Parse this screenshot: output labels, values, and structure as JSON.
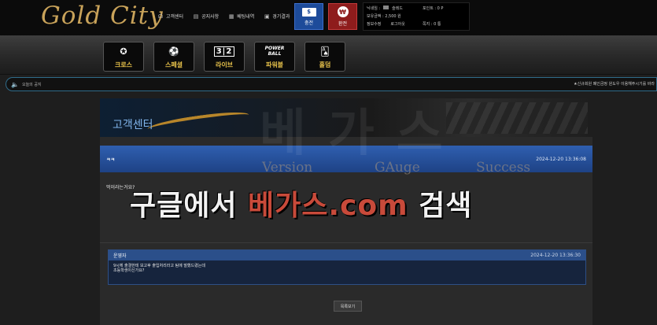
{
  "header": {
    "logo": "Gold City",
    "nav": [
      {
        "label": "고객센터",
        "icon": "headset-icon"
      },
      {
        "label": "공지사항",
        "icon": "clipboard-icon"
      },
      {
        "label": "베팅내역",
        "icon": "ticket-icon"
      },
      {
        "label": "경기결과",
        "icon": "scoreboard-icon"
      }
    ],
    "charge_label": "충전",
    "exchange_label": "환전",
    "user": {
      "nickname_label": "닉네임 :",
      "nickname_value": "슬레드",
      "point_label": "포인트 : 0 P",
      "balance_label": "보유금액 : 2,500 원",
      "info_label": "정보수정",
      "logout_label": "로그아웃",
      "message_label": "쪽지 : 0 통"
    }
  },
  "categories": [
    {
      "label": "크로스",
      "icon": "medal-icon"
    },
    {
      "label": "스페셜",
      "icon": "soccer-ball-icon"
    },
    {
      "label": "라이브",
      "icon": "score-board-icon",
      "glyph": "3|2"
    },
    {
      "label": "파워볼",
      "icon": "powerball-icon",
      "glyph": "POWER\nBALL"
    },
    {
      "label": "홀덤",
      "icon": "cards-icon"
    }
  ],
  "notice": {
    "label": "오늘의 공지",
    "text": "★신규회원 폐인금정 원도우 이용해주시기를 바라"
  },
  "page": {
    "banner_title": "고객센터",
    "question": {
      "title": "ㅋㅋ",
      "date": "2024-12-20 13:36:08",
      "body": "먹이라는거요?"
    },
    "answer": {
      "author": "운영자",
      "date": "2024-12-20 13:36:30",
      "line1": "9시께 출결한테 보고후 출입처리라고 팀에 말했드렸는데",
      "line2": "초등학생이신가요?"
    },
    "list_button": "목록보기"
  },
  "watermark": {
    "big": "베가스",
    "word1": "Version",
    "word2": "GAuge",
    "word3": "Success",
    "main_a": "구글에서 ",
    "main_b": "베가스.com",
    "main_c": " 검색"
  },
  "colors": {
    "gold": "#c9a35a",
    "charge_blue": "#1d4b9a",
    "exchange_red": "#8e1c1c",
    "category_label": "#e6c14a",
    "question_bar": "#2f5fb0",
    "watermark_red": "#c84a3a"
  }
}
